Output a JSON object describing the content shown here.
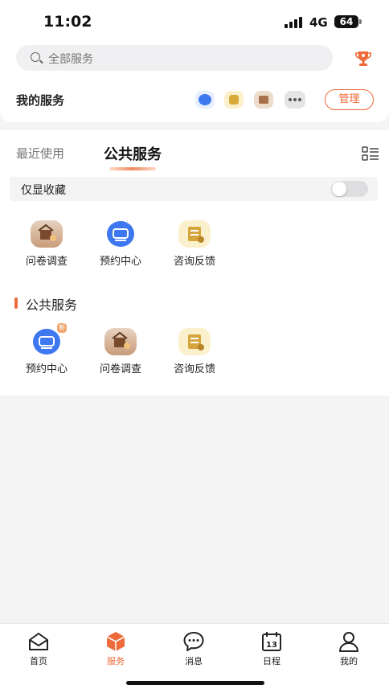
{
  "status": {
    "time": "11:02",
    "network": "4G",
    "battery": "64"
  },
  "search": {
    "placeholder": "全部服务"
  },
  "my_services": {
    "title": "我的服务",
    "manage_label": "管理"
  },
  "tabs": {
    "recent": "最近使用",
    "public": "公共服务"
  },
  "favorites_toggle": {
    "label": "仅显收藏",
    "on": false
  },
  "recent_services": [
    {
      "label": "问卷调查",
      "icon": "survey-icon"
    },
    {
      "label": "预约中心",
      "icon": "booking-icon"
    },
    {
      "label": "咨询反馈",
      "icon": "consult-icon"
    }
  ],
  "public_section": {
    "title": "公共服务",
    "services": [
      {
        "label": "预约中心",
        "icon": "booking-icon",
        "badge": "新"
      },
      {
        "label": "问卷调查",
        "icon": "survey-icon"
      },
      {
        "label": "咨询反馈",
        "icon": "consult-icon"
      }
    ]
  },
  "bottom_nav": [
    {
      "label": "首页",
      "icon": "home-icon"
    },
    {
      "label": "服务",
      "icon": "service-box-icon",
      "active": true
    },
    {
      "label": "消息",
      "icon": "message-icon"
    },
    {
      "label": "日程",
      "icon": "calendar-icon",
      "day": "13"
    },
    {
      "label": "我的",
      "icon": "profile-icon"
    }
  ],
  "colors": {
    "accent": "#ee6a3a",
    "booking_blue": "#3d78f0",
    "consult_bg": "#fbf0cc"
  }
}
